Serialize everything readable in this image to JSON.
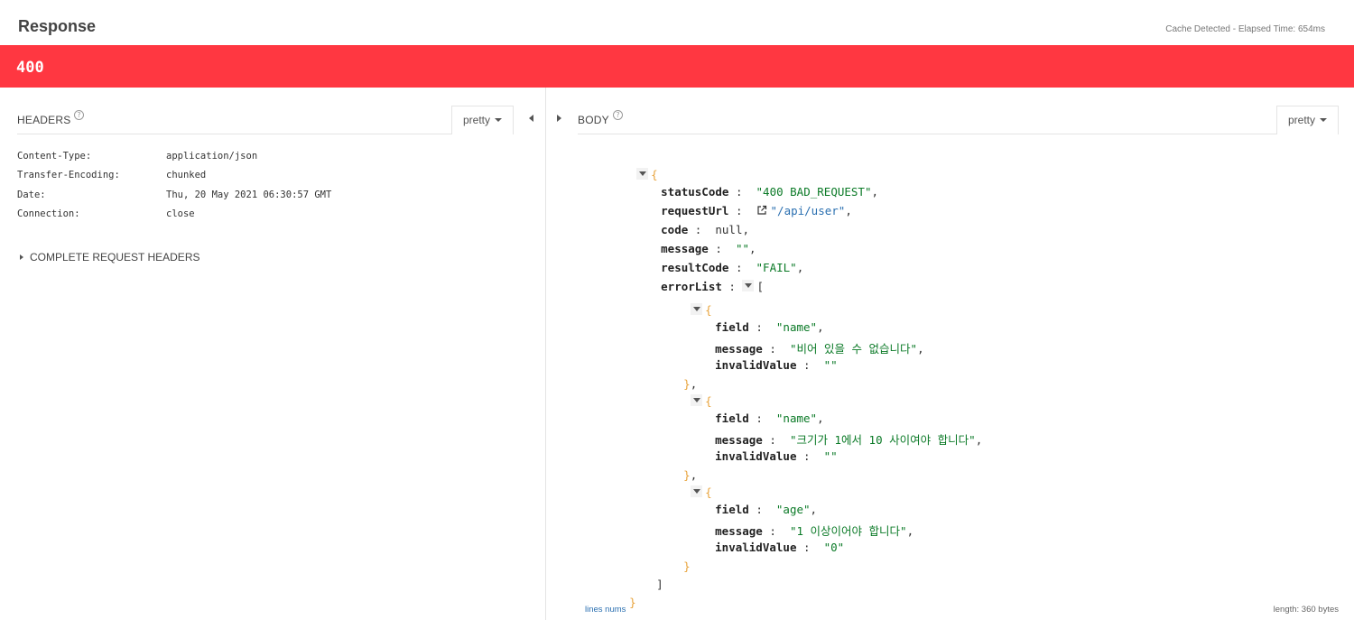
{
  "header": {
    "title": "Response",
    "meta": "Cache Detected - Elapsed Time: 654ms"
  },
  "status": {
    "code": "400",
    "color": "#ff3741"
  },
  "headers_panel": {
    "label": "HEADERS",
    "help_icon": "question-circle-icon",
    "format": "pretty",
    "items": [
      {
        "key": "Content-Type:",
        "value": "application/json"
      },
      {
        "key": "Transfer-Encoding:",
        "value": "chunked"
      },
      {
        "key": "Date:",
        "value": "Thu, 20 May 2021 06:30:57 GMT"
      },
      {
        "key": "Connection:",
        "value": "close"
      }
    ],
    "complete_request_headers": "COMPLETE REQUEST HEADERS"
  },
  "body_panel": {
    "label": "BODY",
    "help_icon": "question-circle-icon",
    "format": "pretty",
    "json": {
      "open_brace": "{",
      "close_brace": "}",
      "open_bracket": "[",
      "close_bracket": "]",
      "statusCode": {
        "key": "statusCode",
        "value": "\"400 BAD_REQUEST\""
      },
      "requestUrl": {
        "key": "requestUrl",
        "value": "\"/api/user\""
      },
      "code": {
        "key": "code",
        "value": "null"
      },
      "message": {
        "key": "message",
        "value": "\"\""
      },
      "resultCode": {
        "key": "resultCode",
        "value": "\"FAIL\""
      },
      "errorList": {
        "key": "errorList",
        "items": [
          {
            "field": "\"name\"",
            "message": "\"비어 있을 수 없습니다\"",
            "invalidValue": "\"\""
          },
          {
            "field": "\"name\"",
            "message": "\"크기가 1에서 10 사이여야 합니다\"",
            "invalidValue": "\"\""
          },
          {
            "field": "\"age\"",
            "message": "\"1 이상이어야 합니다\"",
            "invalidValue": "\"0\""
          }
        ],
        "item_keys": {
          "field": "field",
          "message": "message",
          "invalidValue": "invalidValue"
        }
      }
    },
    "lines_nums": "lines nums",
    "length": "length: 360 bytes"
  }
}
